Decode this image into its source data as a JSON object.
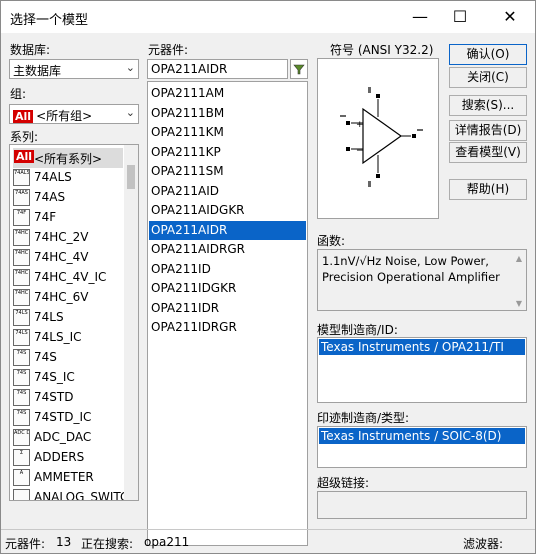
{
  "window": {
    "title": "选择一个模型",
    "minimize": "—",
    "maximize": "☐",
    "close": "✕"
  },
  "database": {
    "label": "数据库:",
    "value": "主数据库"
  },
  "group": {
    "label": "组:",
    "value": "<所有组>",
    "badge": "All"
  },
  "series": {
    "label": "系列:",
    "items": [
      {
        "label": "<所有系列>",
        "icon": "all-badge-icon",
        "badge": "All"
      },
      {
        "label": "74ALS",
        "icon_text": "74ALS"
      },
      {
        "label": "74AS",
        "icon_text": "74AS"
      },
      {
        "label": "74F",
        "icon_text": "74F"
      },
      {
        "label": "74HC_2V",
        "icon_text": "74HC"
      },
      {
        "label": "74HC_4V",
        "icon_text": "74HC"
      },
      {
        "label": "74HC_4V_IC",
        "icon_text": "74HC"
      },
      {
        "label": "74HC_6V",
        "icon_text": "74HC"
      },
      {
        "label": "74LS",
        "icon_text": "74LS"
      },
      {
        "label": "74LS_IC",
        "icon_text": "74LS"
      },
      {
        "label": "74S",
        "icon_text": "74S"
      },
      {
        "label": "74S_IC",
        "icon_text": "74S"
      },
      {
        "label": "74STD",
        "icon_text": "74S"
      },
      {
        "label": "74STD_IC",
        "icon_text": "74S"
      },
      {
        "label": "ADC_DAC",
        "icon_text": "ADC DAC"
      },
      {
        "label": "ADDERS",
        "icon_text": "Σ"
      },
      {
        "label": "AMMETER",
        "icon_text": "A"
      },
      {
        "label": "ANALOG_SWITCH",
        "icon_text": ""
      }
    ]
  },
  "component": {
    "label": "元器件:",
    "search_value": "OPA211AIDR",
    "items": [
      "OPA2111AM",
      "OPA2111BM",
      "OPA2111KM",
      "OPA2111KP",
      "OPA2111SM",
      "OPA211AID",
      "OPA211AIDGKR",
      "OPA211AIDR",
      "OPA211AIDRGR",
      "OPA211ID",
      "OPA211IDGKR",
      "OPA211IDR",
      "OPA211IDRGR"
    ],
    "selected_index": 7
  },
  "symbol": {
    "label": "符号 (ANSI Y32.2)",
    "plus": "+",
    "minus": "−"
  },
  "buttons": {
    "ok": "确认(O)",
    "close": "关闭(C)",
    "search": "搜索(S)...",
    "report": "详情报告(D)",
    "view_model": "查看模型(V)",
    "help": "帮助(H)"
  },
  "function": {
    "label": "函数:",
    "text": "1.1nV/√Hz Noise, Low Power, Precision Operational Amplifier"
  },
  "model_mfr": {
    "label": "模型制造商/ID:",
    "value": "Texas Instruments / OPA211/TI"
  },
  "footprint_mfr": {
    "label": "印迹制造商/类型:",
    "value": "Texas Instruments / SOIC-8(D)"
  },
  "hyperlink": {
    "label": "超级链接:"
  },
  "status": {
    "count_label": "元器件:",
    "count_value": "13",
    "searching_label": "正在搜索:",
    "searching_value": "opa211",
    "filter_label": "滤波器:"
  }
}
